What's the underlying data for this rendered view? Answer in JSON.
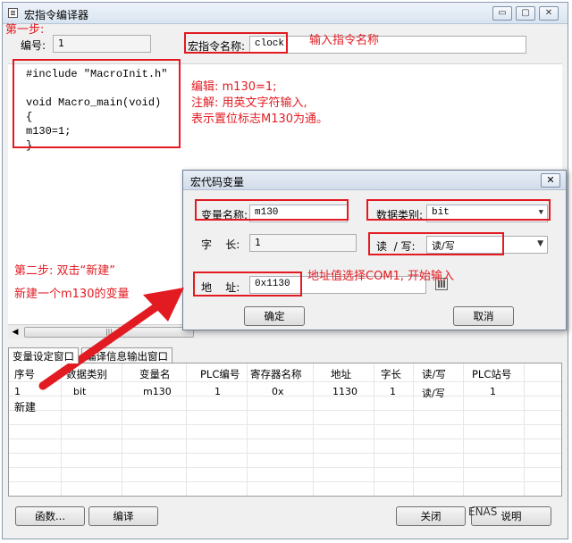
{
  "window": {
    "title": "宏指令编译器",
    "controls": {
      "minimize": "▭",
      "maximize": "▢",
      "close": "✕"
    }
  },
  "header": {
    "number_label": "编号:",
    "number_value": "1",
    "name_label": "宏指令名称:",
    "name_value": "clock"
  },
  "code": {
    "lines": [
      "#include \"MacroInit.h\"",
      "",
      "void Macro_main(void)",
      "{",
      "m130=1;",
      "}"
    ]
  },
  "annotations": {
    "step1": "第一步:",
    "enter_name": "输入指令名称",
    "edit_line1": "编辑: m130=1;",
    "edit_line2": "注解: 用英文字符输入,",
    "edit_line3": "表示置位标志M130为通。",
    "step2_line1": "第二步: 双击“新建”",
    "step2_line2": "新建一个m130的变量",
    "address_hint": "地址值选择COM1, 开始输入"
  },
  "tabs": {
    "variables": "变量设定窗口",
    "output": "编译信息输出窗口"
  },
  "table": {
    "headers": [
      "序号",
      "数据类别",
      "变量名",
      "PLC编号",
      "寄存器名称",
      "地址",
      "字长",
      "读/写",
      "PLC站号"
    ],
    "rows": [
      [
        "1",
        "bit",
        "m130",
        "1",
        "0x",
        "1130",
        "1",
        "读/写",
        "1"
      ],
      [
        "新建",
        "",
        "",
        "",
        "",
        "",
        "",
        "",
        ""
      ]
    ]
  },
  "buttons": {
    "functions": "函数...",
    "compile": "编译",
    "close": "关闭",
    "help": "说明"
  },
  "dialog": {
    "title": "宏代码变量",
    "close": "✕",
    "var_name_label": "变量名称:",
    "var_name_value": "m130",
    "data_type_label": "数据类别:",
    "data_type_value": "bit",
    "word_length_label": "字    长:",
    "word_length_value": "1",
    "rw_label": "读  / 写:",
    "rw_value": "读/写",
    "address_label": "地    址:",
    "address_value": "0x1130",
    "ok": "确定",
    "cancel": "取消"
  },
  "watermark": "ENAS",
  "colors": {
    "annotation": "#e21b22"
  }
}
